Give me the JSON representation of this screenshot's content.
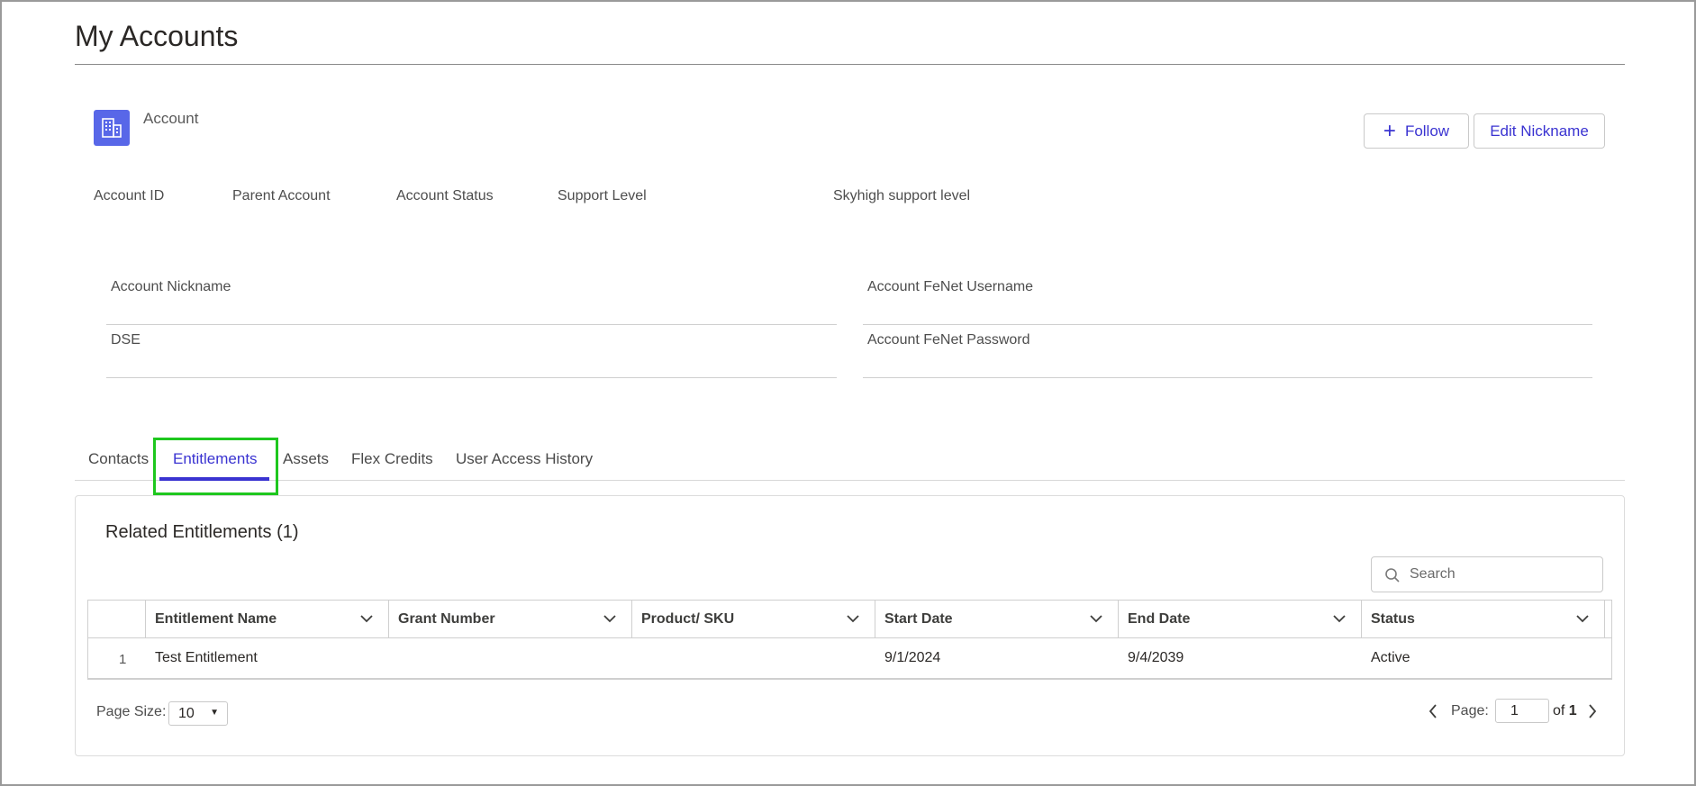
{
  "page": {
    "title": "My Accounts"
  },
  "account": {
    "label": "Account",
    "follow_label": "Follow",
    "edit_nickname_label": "Edit Nickname",
    "fields": {
      "account_id": "Account ID",
      "parent_account": "Parent Account",
      "account_status": "Account Status",
      "support_level": "Support Level",
      "skyhigh_support_level": "Skyhigh support level"
    },
    "details": {
      "account_nickname": "Account Nickname",
      "dse": "DSE",
      "fenet_username": "Account FeNet Username",
      "fenet_password": "Account FeNet Password"
    }
  },
  "tabs": [
    {
      "label": "Contacts"
    },
    {
      "label": "Entitlements",
      "active": true
    },
    {
      "label": "Assets"
    },
    {
      "label": "Flex Credits"
    },
    {
      "label": "User Access History"
    }
  ],
  "related": {
    "title": "Related Entitlements (1)",
    "search_placeholder": "Search",
    "columns": [
      "Entitlement Name",
      "Grant Number",
      "Product/ SKU",
      "Start Date",
      "End Date",
      "Status"
    ],
    "rows": [
      {
        "num": "1",
        "entitlement_name": "Test Entitlement",
        "grant_number": "",
        "product_sku": "",
        "start_date": "9/1/2024",
        "end_date": "9/4/2039",
        "status": "Active"
      }
    ]
  },
  "pagination": {
    "page_size_label": "Page Size:",
    "page_size": "10",
    "page_label": "Page:",
    "page": "1",
    "of_label": "of",
    "total_pages": "1"
  },
  "colors": {
    "accent": "#3a33d1",
    "icon_bg": "#5867e8",
    "highlight": "#1ec71e"
  },
  "icons": [
    "building-icon",
    "plus-icon",
    "search-icon",
    "chevron-down-icon",
    "chevron-left-icon",
    "chevron-right-icon"
  ]
}
